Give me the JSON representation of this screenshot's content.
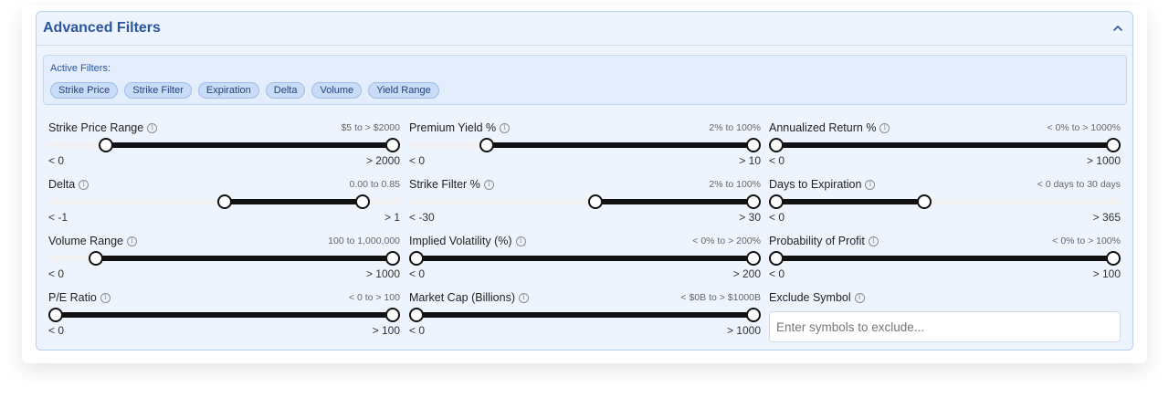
{
  "panel": {
    "title": "Advanced Filters"
  },
  "active_filters": {
    "label": "Active Filters:",
    "chips": [
      "Strike Price",
      "Strike Filter",
      "Expiration",
      "Delta",
      "Volume",
      "Yield Range"
    ]
  },
  "filters": [
    {
      "label": "Strike Price Range",
      "range_text": "$5 to > $2000",
      "min_label": "< 0",
      "max_label": "> 2000",
      "low_fraction": 0.15,
      "high_fraction": 1.0
    },
    {
      "label": "Premium Yield %",
      "range_text": "2% to 100%",
      "min_label": "< 0",
      "max_label": "> 10",
      "low_fraction": 0.21,
      "high_fraction": 1.0
    },
    {
      "label": "Annualized Return %",
      "range_text": "< 0% to > 1000%",
      "min_label": "< 0",
      "max_label": "> 1000",
      "low_fraction": 0.0,
      "high_fraction": 1.0
    },
    {
      "label": "Delta",
      "range_text": "0.00 to 0.85",
      "min_label": "< -1",
      "max_label": "> 1",
      "low_fraction": 0.5,
      "high_fraction": 0.91
    },
    {
      "label": "Strike Filter %",
      "range_text": "2% to 100%",
      "min_label": "< -30",
      "max_label": "> 30",
      "low_fraction": 0.53,
      "high_fraction": 1.0
    },
    {
      "label": "Days to Expiration",
      "range_text": "< 0 days to 30 days",
      "min_label": "< 0",
      "max_label": "> 365",
      "low_fraction": 0.0,
      "high_fraction": 0.44
    },
    {
      "label": "Volume Range",
      "range_text": "100 to 1,000,000",
      "min_label": "< 0",
      "max_label": "> 1000",
      "low_fraction": 0.12,
      "high_fraction": 1.0
    },
    {
      "label": "Implied Volatility (%)",
      "range_text": "< 0% to > 200%",
      "min_label": "< 0",
      "max_label": "> 200",
      "low_fraction": 0.0,
      "high_fraction": 1.0
    },
    {
      "label": "Probability of Profit",
      "range_text": "< 0% to > 100%",
      "min_label": "< 0",
      "max_label": "> 100",
      "low_fraction": 0.0,
      "high_fraction": 1.0
    },
    {
      "label": "P/E Ratio",
      "range_text": "< 0 to > 100",
      "min_label": "< 0",
      "max_label": "> 100",
      "low_fraction": 0.0,
      "high_fraction": 1.0
    },
    {
      "label": "Market Cap (Billions)",
      "range_text": "< $0B to > $1000B",
      "min_label": "< 0",
      "max_label": "> 1000",
      "low_fraction": 0.0,
      "high_fraction": 1.0
    }
  ],
  "exclude": {
    "label": "Exclude Symbol",
    "placeholder": "Enter symbols to exclude...",
    "value": ""
  },
  "colors": {
    "accent": "#2a55a3",
    "panel_bg": "#eef4fd",
    "chip_bg": "#c9dcf7",
    "slider_fill": "#111111"
  }
}
